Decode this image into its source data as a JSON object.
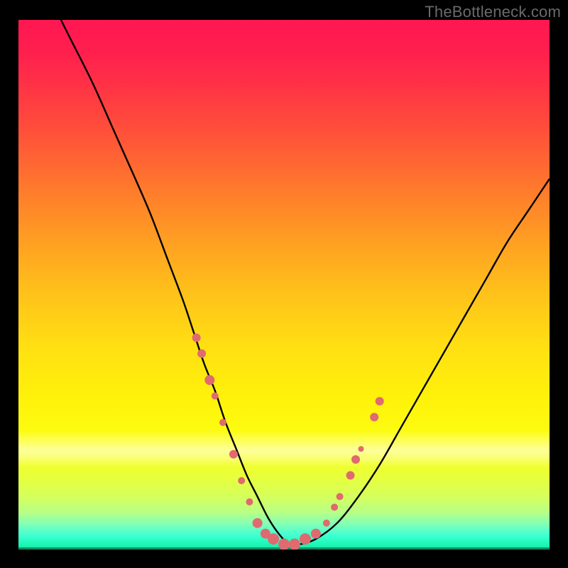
{
  "watermark": "TheBottleneck.com",
  "chart_data": {
    "type": "line",
    "title": "",
    "xlabel": "",
    "ylabel": "",
    "xlim": [
      0,
      100
    ],
    "ylim": [
      0,
      100
    ],
    "grid": false,
    "legend": false,
    "series": [
      {
        "name": "curve",
        "x": [
          8,
          10,
          14,
          18,
          22,
          25,
          28,
          31,
          33,
          35,
          37,
          39,
          41,
          43,
          45,
          47,
          49,
          51,
          53,
          56,
          60,
          64,
          68,
          72,
          76,
          80,
          84,
          88,
          92,
          96,
          100
        ],
        "y": [
          100,
          96,
          88,
          79,
          70,
          63,
          55,
          47,
          41,
          35,
          30,
          24,
          19,
          14,
          10,
          6,
          3,
          1,
          1,
          2,
          5,
          10,
          16,
          23,
          30,
          37,
          44,
          51,
          58,
          64,
          70
        ]
      }
    ],
    "markers": [
      {
        "x": 33.5,
        "y": 40,
        "r": 6
      },
      {
        "x": 34.5,
        "y": 37,
        "r": 6
      },
      {
        "x": 36.0,
        "y": 32,
        "r": 7
      },
      {
        "x": 37.0,
        "y": 29,
        "r": 5
      },
      {
        "x": 38.5,
        "y": 24,
        "r": 5
      },
      {
        "x": 40.5,
        "y": 18,
        "r": 6
      },
      {
        "x": 42.0,
        "y": 13,
        "r": 5
      },
      {
        "x": 43.5,
        "y": 9,
        "r": 5
      },
      {
        "x": 45.0,
        "y": 5,
        "r": 7
      },
      {
        "x": 46.5,
        "y": 3,
        "r": 7
      },
      {
        "x": 48.0,
        "y": 2,
        "r": 8
      },
      {
        "x": 50.0,
        "y": 1,
        "r": 8
      },
      {
        "x": 52.0,
        "y": 1,
        "r": 8
      },
      {
        "x": 54.0,
        "y": 2,
        "r": 8
      },
      {
        "x": 56.0,
        "y": 3,
        "r": 7
      },
      {
        "x": 58.0,
        "y": 5,
        "r": 5
      },
      {
        "x": 59.5,
        "y": 8,
        "r": 5
      },
      {
        "x": 60.5,
        "y": 10,
        "r": 5
      },
      {
        "x": 62.5,
        "y": 14,
        "r": 6
      },
      {
        "x": 63.5,
        "y": 17,
        "r": 6
      },
      {
        "x": 64.5,
        "y": 19,
        "r": 4
      },
      {
        "x": 67.0,
        "y": 25,
        "r": 6
      },
      {
        "x": 68.0,
        "y": 28,
        "r": 6
      }
    ],
    "colors": {
      "curve": "#000000",
      "markers": "#e06a6f"
    }
  }
}
